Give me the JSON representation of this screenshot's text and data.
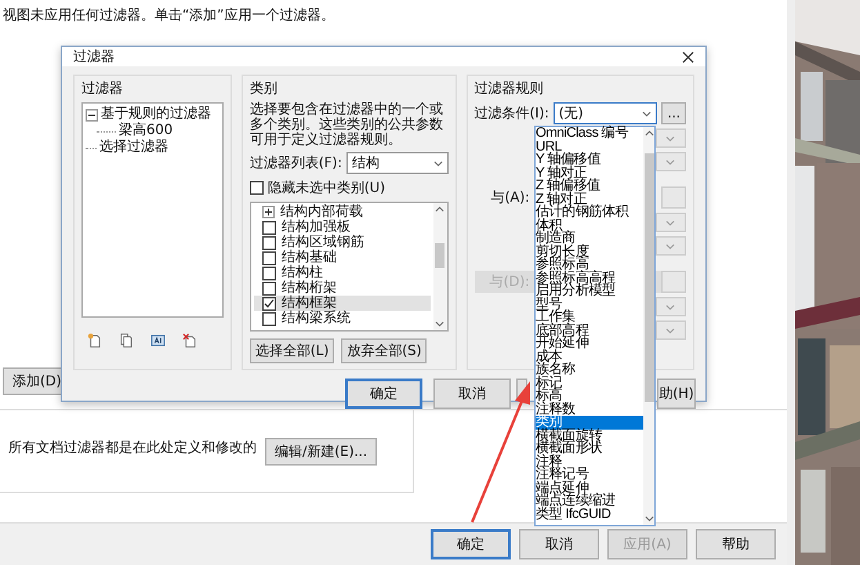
{
  "background_window": {
    "message": "视图未应用任何过滤器。单击“添加”应用一个过滤器。",
    "add_button": "添加(D)",
    "note": "所有文档过滤器都是在此处定义和修改的",
    "edit_button": "编辑/新建(E)...",
    "buttons": [
      {
        "label": "确定",
        "disabled": false
      },
      {
        "label": "取消",
        "disabled": false
      },
      {
        "label": "应用(A)",
        "disabled": true
      },
      {
        "label": "帮助",
        "disabled": false
      }
    ]
  },
  "filter_dialog": {
    "title": "过滤器",
    "filters_group": {
      "title": "过滤器",
      "tree": [
        {
          "label": "基于规则的过滤器",
          "expanded": true,
          "selected": false,
          "children": [
            {
              "label": "梁高600",
              "selected": false
            }
          ]
        },
        {
          "label": "选择过滤器",
          "selected": false
        }
      ]
    },
    "categories_group": {
      "title": "类别",
      "description": "选择要包含在过滤器中的一个或多个类别。这些类别的公共参数可用于定义过滤器规则。",
      "filter_list_label": "过滤器列表(F):",
      "filter_list_value": "结构",
      "hide_unchecked": {
        "label": "隐藏未选中类别(U)",
        "checked": false
      },
      "items": [
        {
          "kind": "group",
          "label": "结构内部荷载",
          "expanded": false,
          "selected": false
        },
        {
          "kind": "item",
          "label": "结构加强板",
          "checked": false,
          "selected": false
        },
        {
          "kind": "item",
          "label": "结构区域钢筋",
          "checked": false,
          "selected": false
        },
        {
          "kind": "item",
          "label": "结构基础",
          "checked": false,
          "selected": false
        },
        {
          "kind": "item",
          "label": "结构柱",
          "checked": false,
          "selected": false
        },
        {
          "kind": "item",
          "label": "结构桁架",
          "checked": false,
          "selected": false
        },
        {
          "kind": "item",
          "label": "结构框架",
          "checked": true,
          "selected": true
        },
        {
          "kind": "item",
          "label": "结构梁系统",
          "checked": false,
          "selected": false
        }
      ],
      "select_all": "选择全部(L)",
      "deselect_all": "放弃全部(S)"
    },
    "rules_group": {
      "title": "过滤器规则",
      "condition_label": "过滤条件(I):",
      "condition_value": "(无)",
      "more_button": "...",
      "and_rows": [
        {
          "label": "与(A):",
          "disabled": false
        },
        {
          "label": "与(D):",
          "disabled": true
        }
      ]
    },
    "buttons": [
      {
        "label": "确定",
        "default": true
      },
      {
        "label": "取消",
        "default": false
      },
      {
        "label": "助(H)",
        "default": false
      }
    ],
    "condition_options": [
      {
        "label": "OmniClass 编号",
        "selected": false
      },
      {
        "label": "URL",
        "selected": false
      },
      {
        "label": "Y 轴偏移值",
        "selected": false
      },
      {
        "label": "Y 轴对正",
        "selected": false
      },
      {
        "label": "Z 轴偏移值",
        "selected": false
      },
      {
        "label": "Z 轴对正",
        "selected": false
      },
      {
        "label": "估计的钢筋体积",
        "selected": false
      },
      {
        "label": "体积",
        "selected": false
      },
      {
        "label": "制造商",
        "selected": false
      },
      {
        "label": "剪切长度",
        "selected": false
      },
      {
        "label": "参照标高",
        "selected": false
      },
      {
        "label": "参照标高高程",
        "selected": false
      },
      {
        "label": "启用分析模型",
        "selected": false
      },
      {
        "label": "型号",
        "selected": false
      },
      {
        "label": "工作集",
        "selected": false
      },
      {
        "label": "底部高程",
        "selected": false
      },
      {
        "label": "开始延伸",
        "selected": false
      },
      {
        "label": "成本",
        "selected": false
      },
      {
        "label": "族名称",
        "selected": false
      },
      {
        "label": "标记",
        "selected": false
      },
      {
        "label": "标高",
        "selected": false
      },
      {
        "label": "注释数",
        "selected": false
      },
      {
        "label": "类别",
        "selected": true
      },
      {
        "label": "横截面旋转",
        "selected": false
      },
      {
        "label": "横截面形状",
        "selected": false
      },
      {
        "label": "注释",
        "selected": false
      },
      {
        "label": "注释记号",
        "selected": false
      },
      {
        "label": "端点延伸",
        "selected": false
      },
      {
        "label": "端点连续缩进",
        "selected": false
      },
      {
        "label": "类型 IfcGUID",
        "selected": false
      }
    ]
  }
}
